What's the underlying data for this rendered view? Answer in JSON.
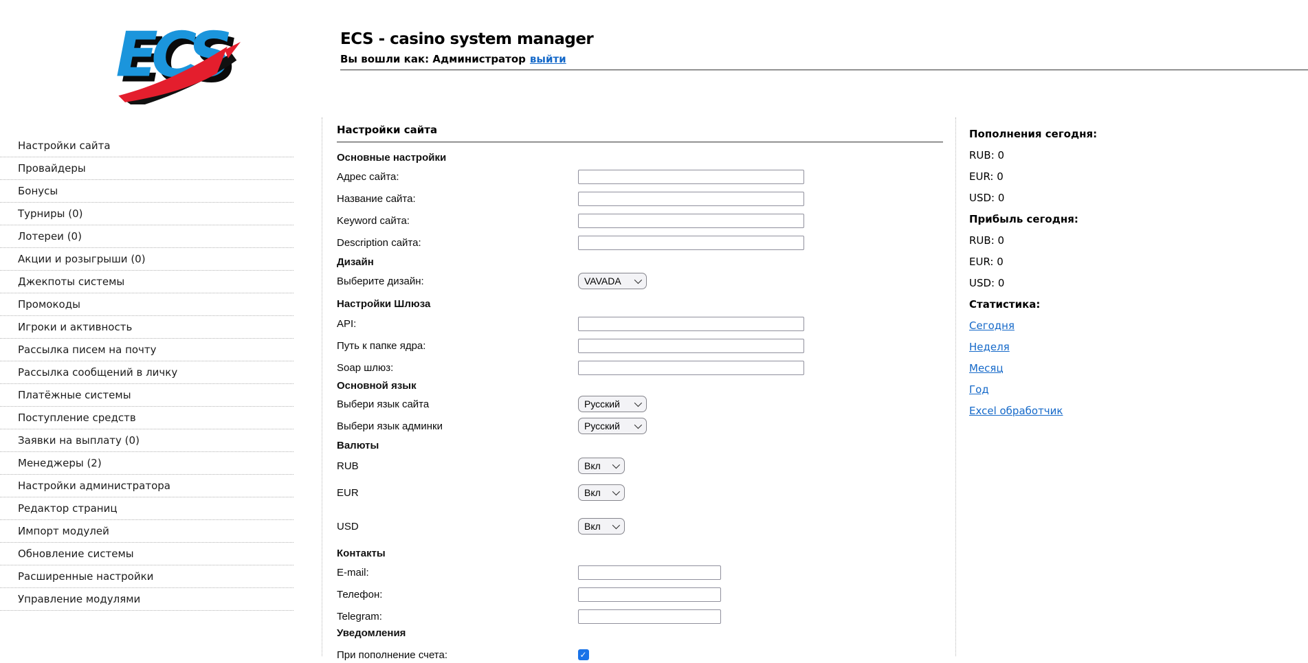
{
  "header": {
    "logo_text": "ECS",
    "title": "ECS - casino system manager",
    "login_prefix": "Вы вошли как: Администратор",
    "logout": "выйти"
  },
  "sidebar": {
    "items": [
      {
        "label": "Настройки сайта"
      },
      {
        "label": "Провайдеры"
      },
      {
        "label": "Бонусы"
      },
      {
        "label": "Турниры (0)"
      },
      {
        "label": "Лотереи (0)"
      },
      {
        "label": "Акции и розыгрыши (0)"
      },
      {
        "label": "Джекпоты системы"
      },
      {
        "label": "Промокоды"
      },
      {
        "label": "Игроки и активность"
      },
      {
        "label": "Рассылка писем на почту"
      },
      {
        "label": "Рассылка сообщений в личку"
      },
      {
        "label": "Платёжные системы"
      },
      {
        "label": "Поступление средств"
      },
      {
        "label": "Заявки на выплату (0)"
      },
      {
        "label": "Менеджеры (2)"
      },
      {
        "label": "Настройки администратора"
      },
      {
        "label": "Редактор страниц"
      },
      {
        "label": "Импорт модулей"
      },
      {
        "label": "Обновление системы"
      },
      {
        "label": "Расширенные настройки"
      },
      {
        "label": "Управление модулями"
      }
    ]
  },
  "main": {
    "title": "Настройки сайта",
    "form": [
      {
        "type": "heading",
        "label": "Основные настройки"
      },
      {
        "type": "text",
        "label": "Адрес сайта:",
        "value": ""
      },
      {
        "type": "text",
        "label": "Название сайта:",
        "value": ""
      },
      {
        "type": "text",
        "label": "Keyword сайта:",
        "value": ""
      },
      {
        "type": "text",
        "label": "Description сайта:",
        "value": ""
      },
      {
        "type": "heading",
        "label": "Дизайн"
      },
      {
        "type": "select",
        "label": "Выберите дизайн:",
        "value": "VAVADA"
      },
      {
        "type": "heading",
        "label": "Настройки Шлюза"
      },
      {
        "type": "text",
        "label": "API:",
        "value": ""
      },
      {
        "type": "text",
        "label": "Путь к папке ядра:",
        "value": ""
      },
      {
        "type": "text",
        "label": "Soap шлюз:",
        "value": ""
      },
      {
        "type": "heading",
        "label": "Основной язык"
      },
      {
        "type": "select",
        "label": "Выбери язык сайта",
        "value": "Русский"
      },
      {
        "type": "select",
        "label": "Выбери язык админки",
        "value": "Русский"
      },
      {
        "type": "heading",
        "label": "Валюты"
      },
      {
        "type": "select",
        "label": "RUB",
        "value": "Вкл"
      },
      {
        "type": "select",
        "label": "EUR",
        "value": "Вкл"
      },
      {
        "type": "select",
        "label": "USD",
        "value": "Вкл"
      },
      {
        "type": "heading",
        "label": "Контакты"
      },
      {
        "type": "text",
        "label": "E-mail:",
        "value": ""
      },
      {
        "type": "text",
        "label": "Телефон:",
        "value": ""
      },
      {
        "type": "text",
        "label": "Telegram:",
        "value": ""
      },
      {
        "type": "heading",
        "label": "Уведомления"
      },
      {
        "type": "checkbox",
        "label": "При пополнение счета:",
        "checked": true
      }
    ]
  },
  "stats": {
    "rows": [
      {
        "type": "header",
        "label": "Пополнения сегодня:"
      },
      {
        "type": "stat",
        "label": "RUB:",
        "value": "0"
      },
      {
        "type": "stat",
        "label": "EUR:",
        "value": "0"
      },
      {
        "type": "stat",
        "label": "USD:",
        "value": "0"
      },
      {
        "type": "header",
        "label": "Прибыль сегодня:"
      },
      {
        "type": "stat",
        "label": "RUB:",
        "value": "0"
      },
      {
        "type": "stat",
        "label": "EUR:",
        "value": "0"
      },
      {
        "type": "stat",
        "label": "USD:",
        "value": "0"
      },
      {
        "type": "header",
        "label": "Статистика:"
      },
      {
        "type": "link",
        "label": "Сегодня"
      },
      {
        "type": "link",
        "label": "Неделя"
      },
      {
        "type": "link",
        "label": "Месяц"
      },
      {
        "type": "link",
        "label": "Год"
      },
      {
        "type": "link",
        "label": "Excel обработчик"
      }
    ]
  },
  "colors": {
    "link_blue": "#1569c9",
    "checkbox_blue": "#1a73e8",
    "logo_blue": "#1b95dc",
    "logo_red": "#e41e2d",
    "rule_gray": "#5f5f5f"
  }
}
